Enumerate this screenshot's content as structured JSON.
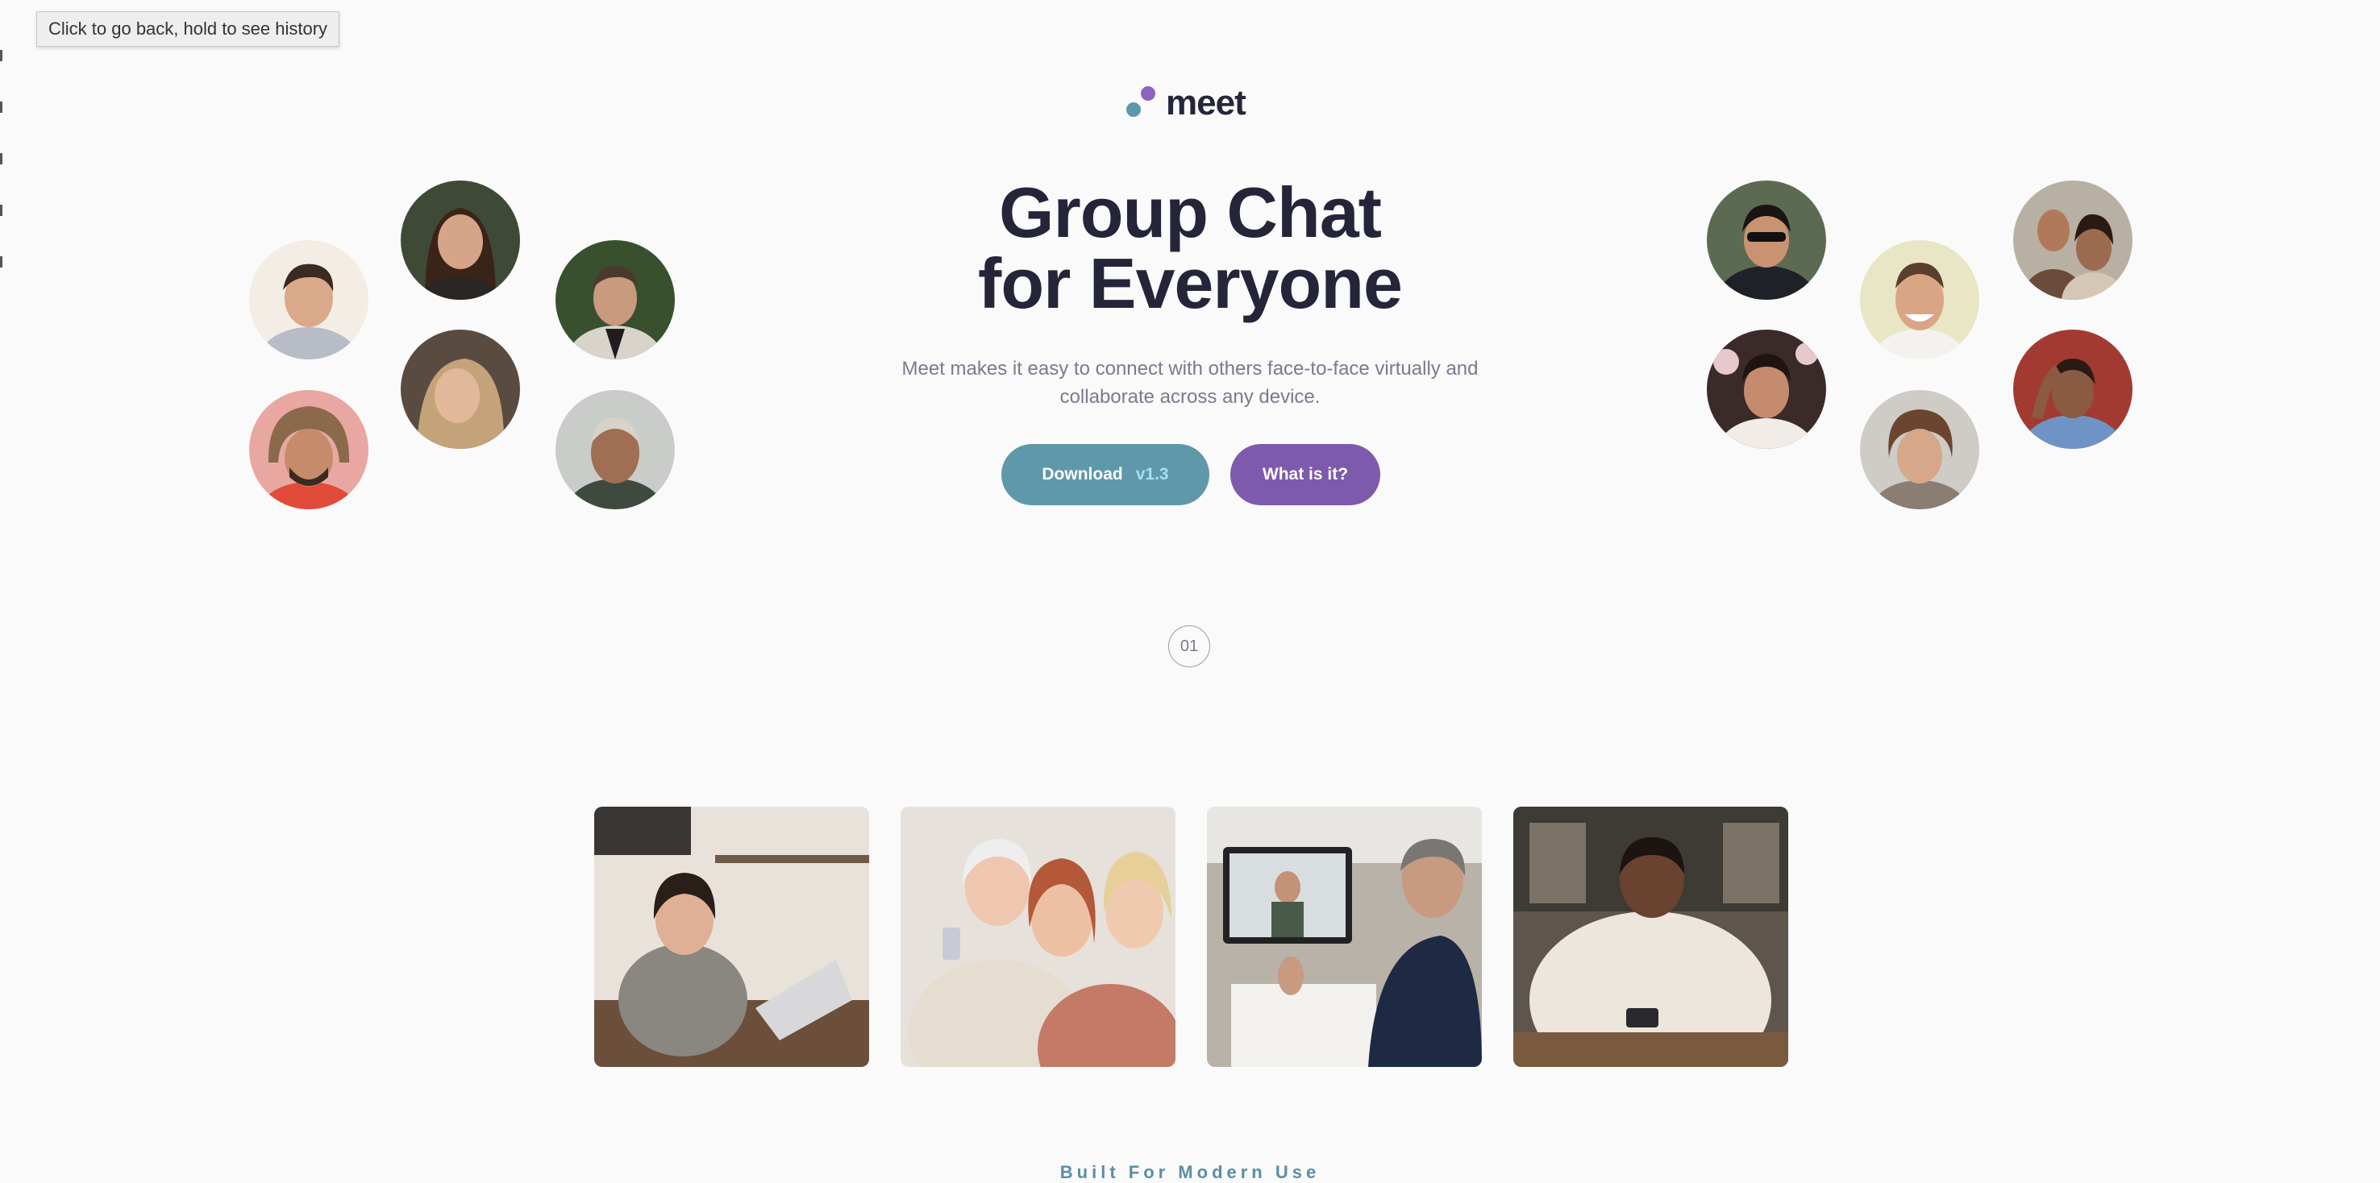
{
  "browser": {
    "tooltip": "Click to go back, hold to see history"
  },
  "brand": {
    "name": "meet",
    "dot_colors": [
      "#8a64bf",
      "#5b98aa"
    ]
  },
  "hero": {
    "headline_line1": "Group Chat",
    "headline_line2": "for Everyone",
    "subtext_line1": "Meet makes it easy to connect with others face-to-face virtually and",
    "subtext_line2": "collaborate across any device.",
    "download_label": "Download",
    "download_version": "v1.3",
    "what_label": "What is it?"
  },
  "section": {
    "number": "01",
    "footer_heading": "Built For Modern Use"
  },
  "colors": {
    "accent_teal": "#5f98a9",
    "accent_purple": "#7e5aac",
    "background": "#fafafb",
    "heading": "#25253a"
  }
}
